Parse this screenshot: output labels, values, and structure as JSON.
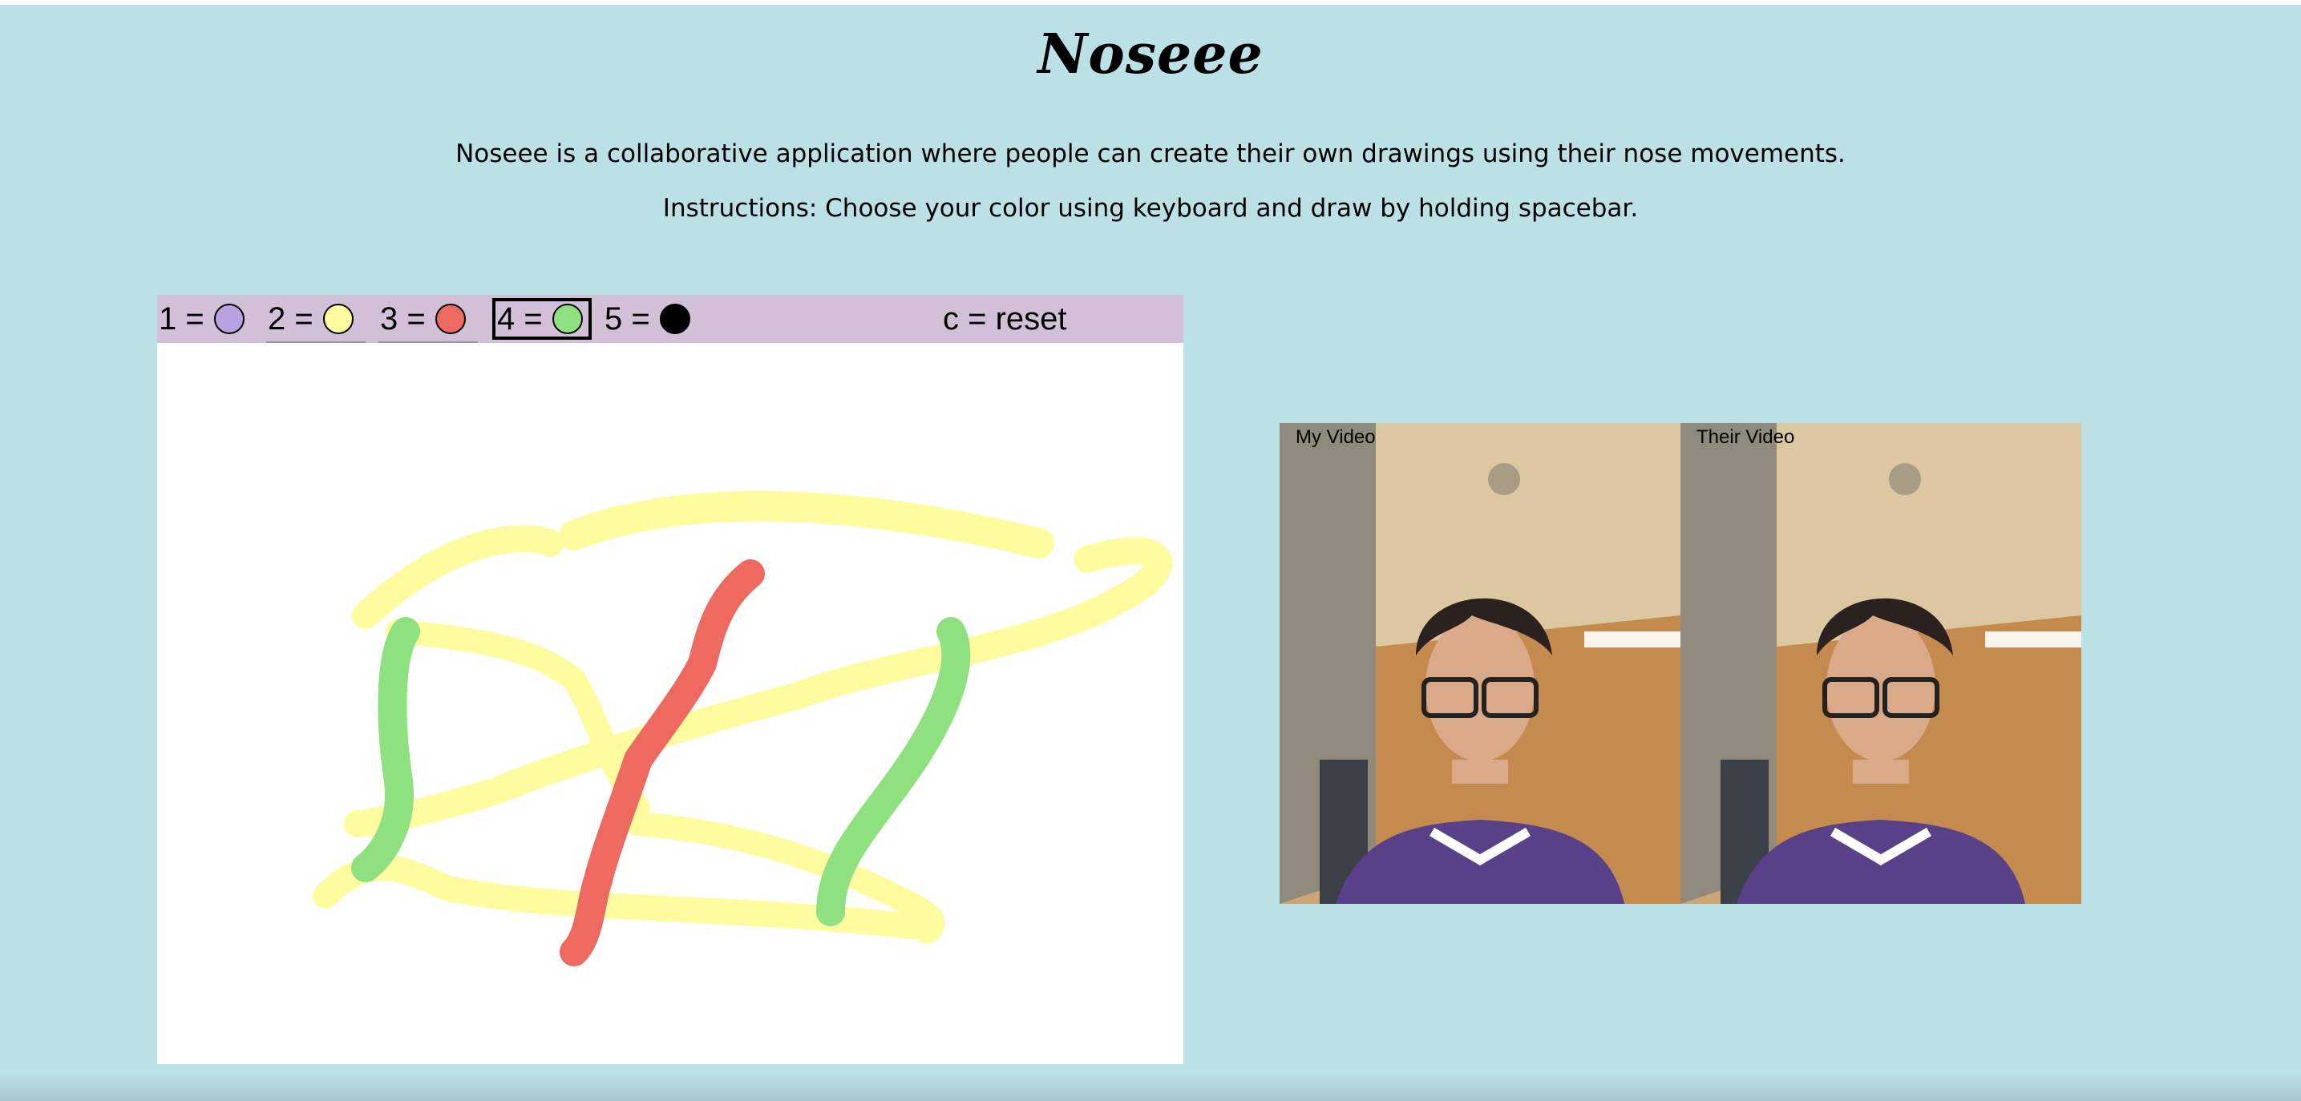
{
  "header": {
    "title": "Noseee",
    "description": "Noseee is a collaborative application where people can create their own drawings using their nose movements.",
    "instructions": "Instructions: Choose your color using keyboard and draw by holding spacebar."
  },
  "toolbar": {
    "colors": [
      {
        "label": "1 =",
        "color": "#b8a3e0"
      },
      {
        "label": "2 =",
        "color": "#fffca0"
      },
      {
        "label": "3 =",
        "color": "#ee6a60"
      },
      {
        "label": "4 =",
        "color": "#8fe07f"
      },
      {
        "label": "5 =",
        "color": "#000000"
      }
    ],
    "selected_index": 3,
    "reset_label": "c = reset"
  },
  "videos": {
    "my_label": "My Video",
    "their_label": "Their Video"
  },
  "theme": {
    "background": "#bbe0e5",
    "toolbar_background": "#d2c0d8",
    "canvas_background": "#ffffff"
  }
}
